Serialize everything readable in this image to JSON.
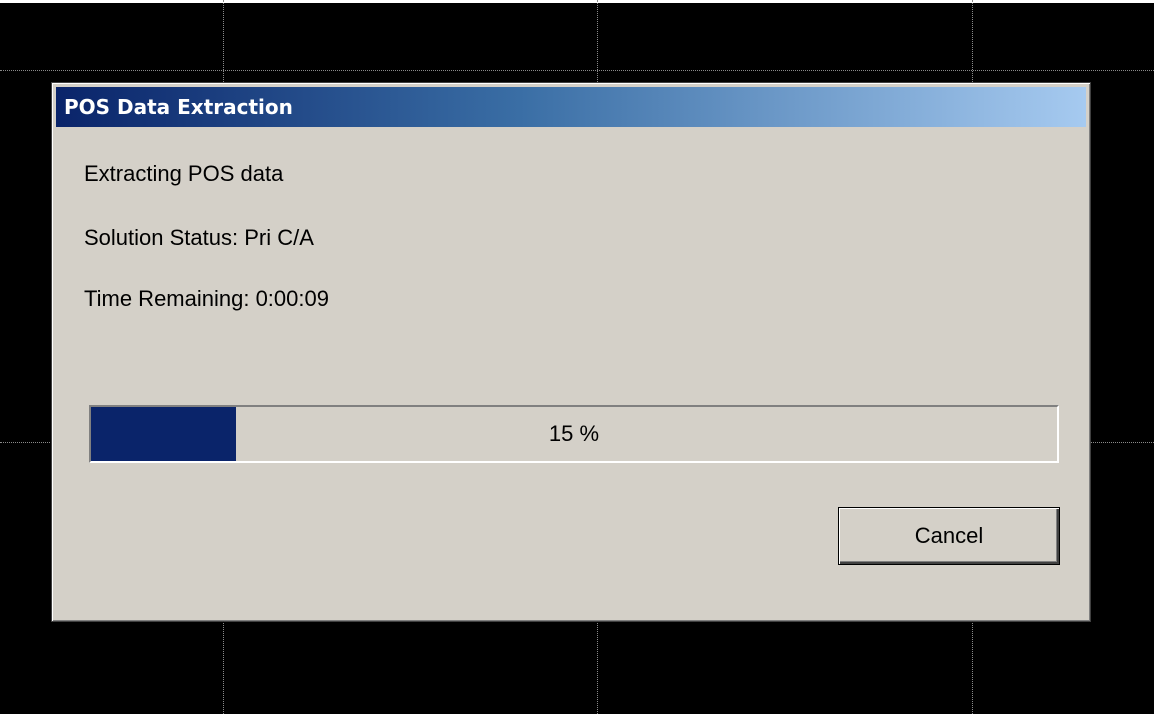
{
  "dialog": {
    "title": "POS Data Extraction",
    "message": "Extracting POS data",
    "solution_status": "Solution Status:  Pri C/A",
    "time_remaining": "Time Remaining: 0:00:09",
    "progress": {
      "percent": 15,
      "label": "15 %"
    },
    "cancel_label": "Cancel"
  },
  "colors": {
    "titlebar_start": "#0a246a",
    "titlebar_end": "#a6caf0",
    "progress_fill": "#0a246a",
    "dialog_face": "#d4d0c8",
    "background": "#000000"
  }
}
